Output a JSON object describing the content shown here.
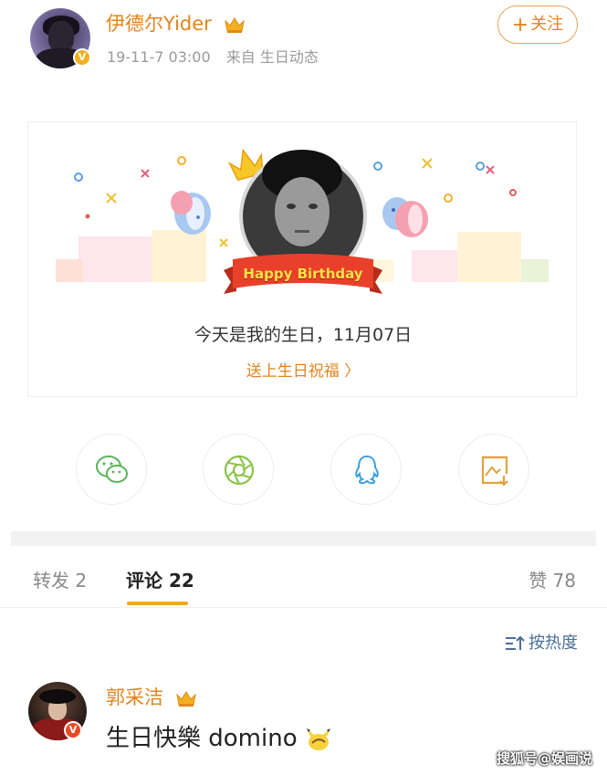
{
  "post": {
    "username": "伊德尔Yider",
    "time": "19-11-7 03:00",
    "source": "来自 生日动态",
    "follow_label": "关注",
    "verified_badge": "V"
  },
  "birthday_card": {
    "banner": "Happy Birthday",
    "message": "今天是我的生日，11月07日",
    "link": "送上生日祝福 〉"
  },
  "share": [
    {
      "icon": "wechat-icon"
    },
    {
      "icon": "moments-icon"
    },
    {
      "icon": "qq-icon"
    },
    {
      "icon": "save-image-icon"
    }
  ],
  "tabs": {
    "repost": "转发 2",
    "comments": "评论 22",
    "likes": "赞 78"
  },
  "sort_label": "按热度",
  "comment": {
    "author": "郭采洁",
    "text": "生日快樂 domino",
    "badge": "V"
  },
  "watermark": "搜狐号@娱画说",
  "colors": {
    "accent": "#e2841e",
    "tab_underline": "#f5a623",
    "link_blue": "#4a6f99",
    "banner_red": "#e8402a"
  }
}
